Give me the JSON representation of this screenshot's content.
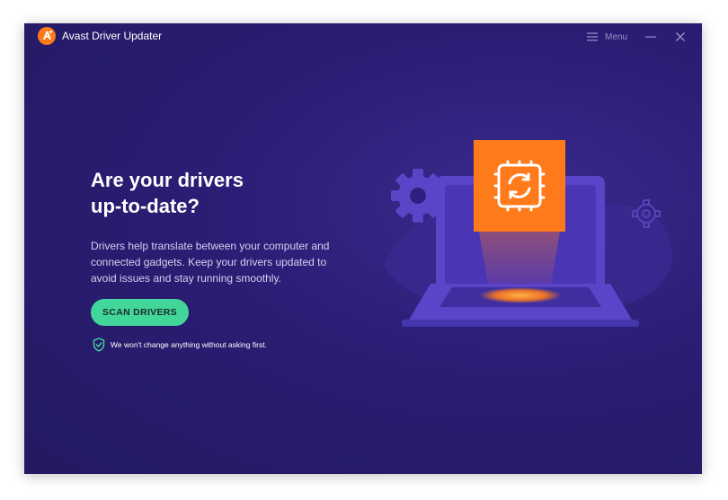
{
  "window": {
    "title": "Avast Driver Updater",
    "menu_label": "Menu"
  },
  "main": {
    "headline_line1": "Are your drivers",
    "headline_line2": "up-to-date?",
    "description_lines": [
      "Drivers help translate between your computer and",
      "connected gadgets. Keep your drivers updated to",
      "avoid issues and stay running smoothly."
    ],
    "scan_button_label": "SCAN DRIVERS",
    "assurance_text": "We won't change anything without asking first."
  },
  "icons": {
    "logo": "avast-logo",
    "menu": "hamburger-icon",
    "minimize": "minimize-icon",
    "close": "close-icon",
    "assurance": "shield-check-icon"
  },
  "colors": {
    "background": "#2a1d74",
    "accent_orange": "#ff7a1a",
    "button_green": "#43d69b",
    "illustration_purple": "#5a45c8"
  }
}
